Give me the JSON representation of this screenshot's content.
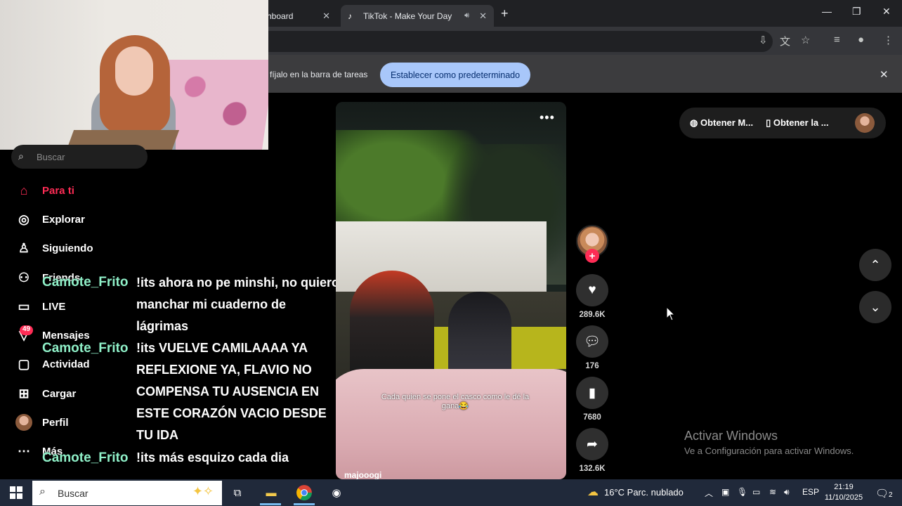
{
  "browser": {
    "tabs": [
      {
        "label": "hboard"
      },
      {
        "label": "TikTok - Make Your Day"
      }
    ],
    "infobar": {
      "text": "fíjalo en la barra de tareas",
      "button": "Establecer como predeterminado"
    }
  },
  "sidebar": {
    "search_placeholder": "Buscar",
    "items": [
      {
        "label": "Para ti",
        "icon": "home-icon"
      },
      {
        "label": "Explorar",
        "icon": "compass-icon"
      },
      {
        "label": "Siguiendo",
        "icon": "following-icon"
      },
      {
        "label": "Friends",
        "icon": "friends-icon"
      },
      {
        "label": "LIVE",
        "icon": "live-icon"
      },
      {
        "label": "Mensajes",
        "icon": "inbox-icon"
      },
      {
        "label": "Actividad",
        "icon": "activity-icon"
      },
      {
        "label": "Cargar",
        "icon": "upload-icon"
      },
      {
        "label": "Perfil",
        "icon": "avatar"
      },
      {
        "label": "Más",
        "icon": "more-icon"
      }
    ],
    "messages_badge": "49"
  },
  "chat": [
    {
      "user": "Camote_Frito",
      "message": "!its ahora no pe minshi, no quiero manchar mi cuaderno de lágrimas"
    },
    {
      "user": "Camote_Frito",
      "message": "!its VUELVE CAMILAAAA YA REFLEXIONE YA, FLAVIO NO COMPENSA TU AUSENCIA EN ESTE CORAZÓN VACIO DESDE TU IDA"
    },
    {
      "user": "Camote_Frito",
      "message": "!its más esquizo cada dia"
    }
  ],
  "video": {
    "caption": "Cada quien se pone el casco como le dé la gana😂",
    "author": "majooogi",
    "likes": "289.6K",
    "comments": "176",
    "saves": "7680",
    "shares": "132.6K"
  },
  "topright": {
    "get_app": "Obtener M...",
    "get_pc": "Obtener la ..."
  },
  "watermark": {
    "title": "Activar Windows",
    "subtitle": "Ve a Configuración para activar Windows."
  },
  "taskbar": {
    "search_placeholder": "Buscar",
    "weather": "16°C  Parc. nublado",
    "language": "ESP",
    "time": "21:19",
    "date": "11/10/2025",
    "notifications": "2"
  }
}
